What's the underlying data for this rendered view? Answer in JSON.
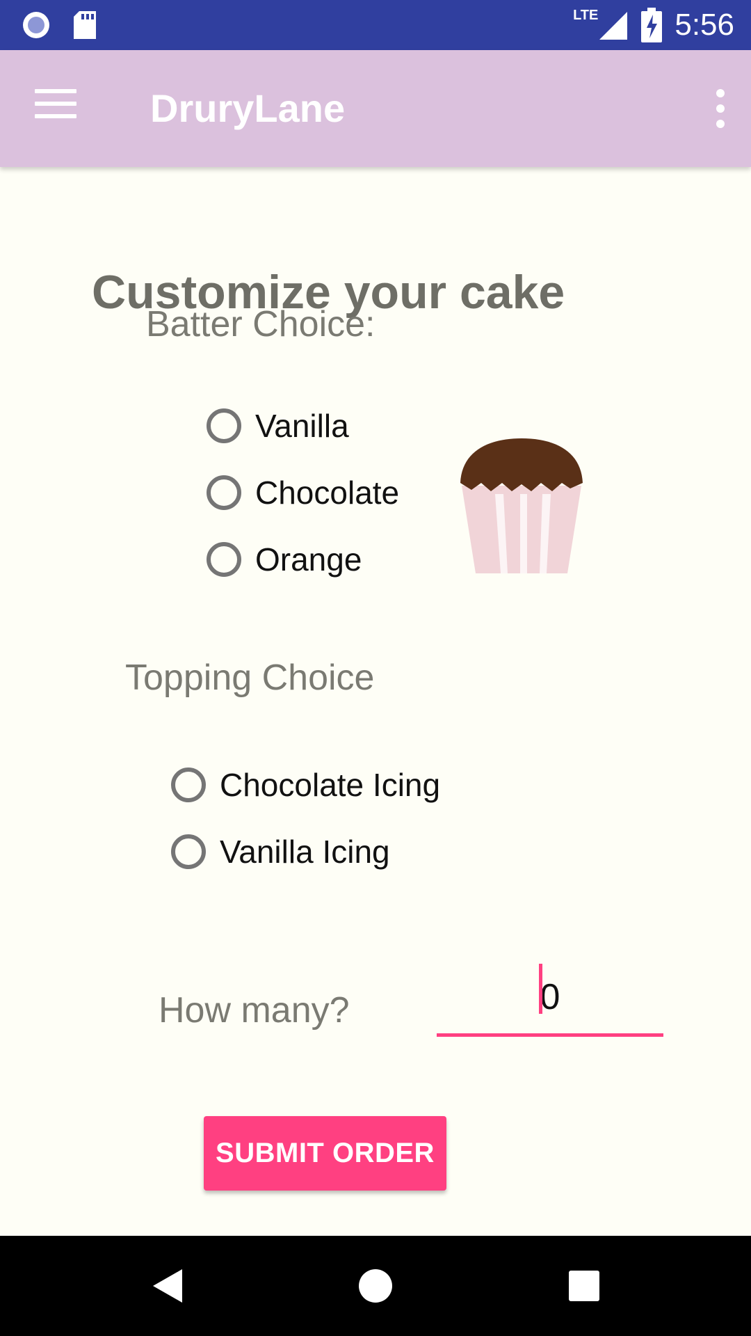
{
  "status_bar": {
    "time": "5:56",
    "network": "LTE",
    "icons": [
      "radio-icon",
      "sd-card-icon",
      "signal-icon",
      "battery-charging-icon"
    ]
  },
  "app_bar": {
    "title": "DruryLane",
    "icons": [
      "hamburger-menu-icon",
      "overflow-menu-icon"
    ],
    "background": "#dbc1dd"
  },
  "page": {
    "title": "Customize your cake"
  },
  "batter": {
    "label": "Batter Choice:",
    "options": [
      "Vanilla",
      "Chocolate",
      "Orange"
    ]
  },
  "topping": {
    "label": "Topping Choice",
    "options": [
      "Chocolate Icing",
      "Vanilla Icing"
    ]
  },
  "quantity": {
    "label": "How many?",
    "value": "0"
  },
  "submit": {
    "label": "SUBMIT ORDER"
  },
  "colors": {
    "status_bar": "#303f9f",
    "accent": "#ff4081",
    "background": "#fefef6"
  },
  "nav_bar": {
    "icons": [
      "back-icon",
      "home-icon",
      "recents-icon"
    ]
  }
}
